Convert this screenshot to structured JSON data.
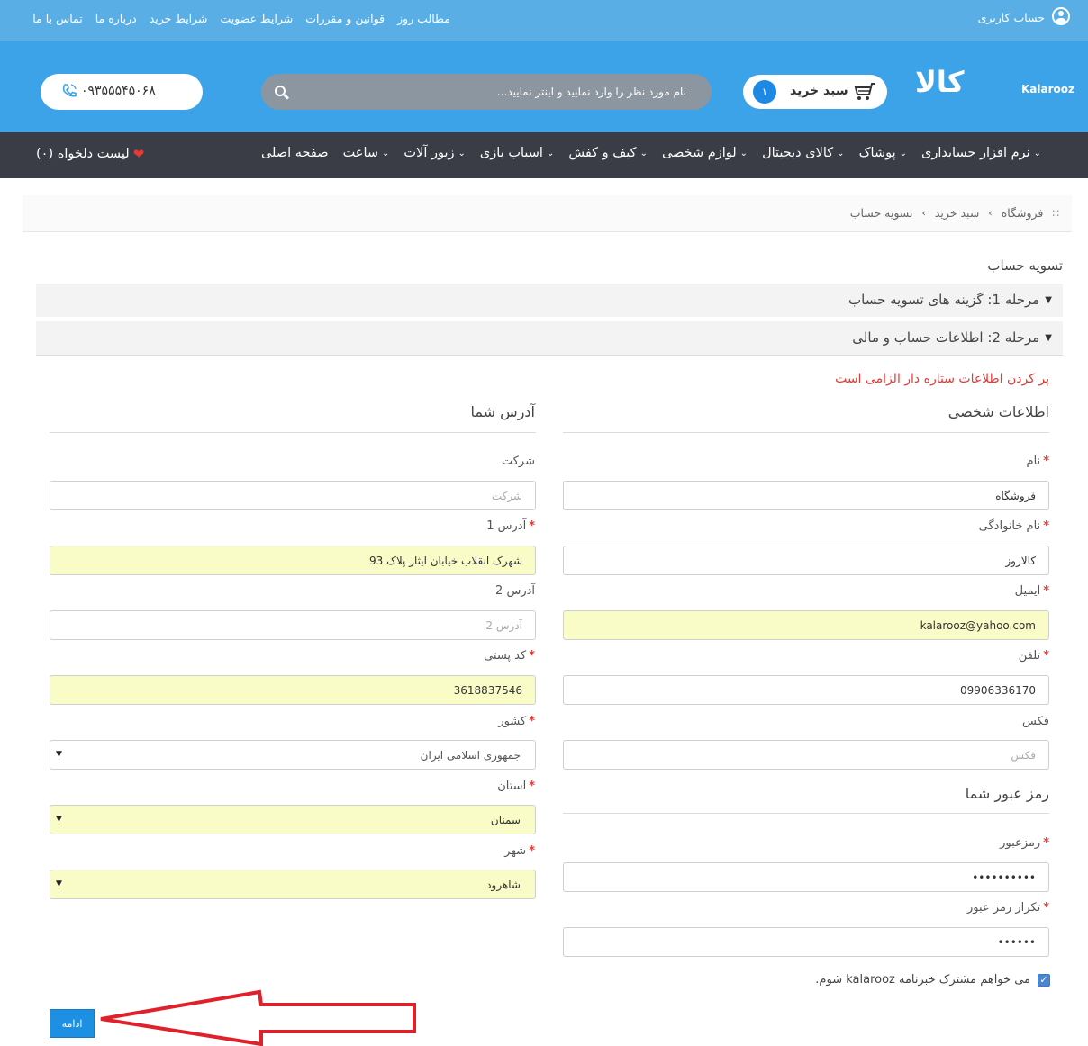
{
  "topbar": {
    "links": [
      "تماس با ما",
      "درباره ما",
      "شرایط خرید",
      "شرایط عضویت",
      "قوانین و مقررات",
      "مطالب روز"
    ],
    "account_label": "حساب کاربری"
  },
  "header": {
    "logo_text": "کالا",
    "logo_latin": "Kalarooz",
    "cart_label": "سبد خرید",
    "cart_count": "۱",
    "search_placeholder": "نام مورد نظر را وارد نمایید و اینتر نمایید...",
    "phone": "۰۹۳۵۵۵۴۵۰۶۸"
  },
  "nav": {
    "items": [
      "صفحه اصلی",
      "ساعت",
      "زیور آلات",
      "اسباب بازی",
      "کیف و کفش",
      "لوازم شخصی",
      "کالای دیجیتال",
      "پوشاک",
      "نرم افزار حسابداری"
    ],
    "wishlist": "لیست دلخواه (۰)"
  },
  "breadcrumb": [
    "فروشگاه",
    "سبد خرید",
    "تسویه حساب"
  ],
  "page": {
    "title": "تسویه حساب",
    "step1": "مرحله 1: گزینه های تسویه حساب",
    "step2": "مرحله 2: اطلاعات حساب و مالی",
    "required_note": "پر کردن اطلاعات ستاره دار الزامی است"
  },
  "personal": {
    "title": "اطلاعات شخصی",
    "first_name": {
      "label": "نام",
      "value": "فروشگاه"
    },
    "last_name": {
      "label": "نام خانوادگی",
      "value": "کالاروز"
    },
    "email": {
      "label": "ایمیل",
      "value": "kalarooz@yahoo.com"
    },
    "phone": {
      "label": "تلفن",
      "value": "09906336170"
    },
    "fax": {
      "label": "فکس",
      "placeholder": "فکس"
    }
  },
  "password": {
    "title": "رمز عبور شما",
    "password": {
      "label": "رمزعبور",
      "value": "••••••••••"
    },
    "confirm": {
      "label": "تکرار رمز عبور",
      "value": "••••••"
    }
  },
  "address": {
    "title": "آدرس شما",
    "company": {
      "label": "شرکت",
      "placeholder": "شرکت"
    },
    "address1": {
      "label": "آدرس 1",
      "value": "شهرک انقلاب خیابان ایثار پلاک 93"
    },
    "address2": {
      "label": "آدرس 2",
      "placeholder": "آدرس 2"
    },
    "postcode": {
      "label": "کد پستی",
      "value": "3618837546"
    },
    "country": {
      "label": "کشور",
      "value": "جمهوری اسلامی ایران"
    },
    "province": {
      "label": "استان",
      "value": "سمنان"
    },
    "city": {
      "label": "شهر",
      "value": "شاهرود"
    }
  },
  "newsletter_label": "می خواهم مشترک خبرنامه kalarooz شوم.",
  "continue_label": "ادامه",
  "colors": {
    "topbar": "#5aaee6",
    "header": "#3da3e8",
    "nav": "#3a3d45",
    "required": "#e53935",
    "autofill": "#fafcc8",
    "button": "#1e90e4",
    "annotation_arrow": "#e0202a"
  }
}
